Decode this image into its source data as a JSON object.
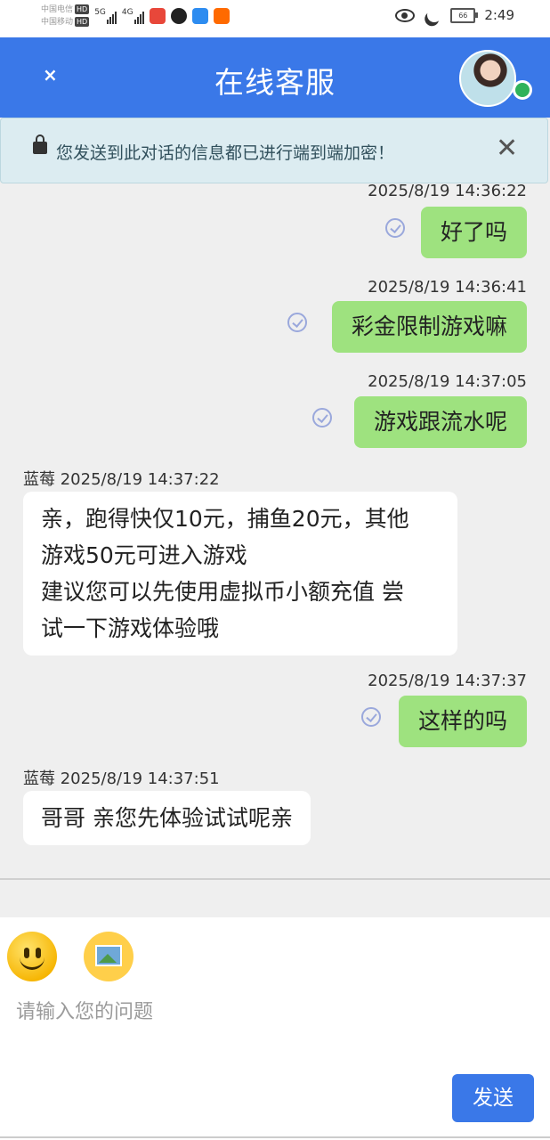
{
  "status_bar": {
    "carrier_1": "中国电信",
    "carrier_2": "中国移动",
    "hd": "HD",
    "net_1": "5G",
    "net_2": "4G",
    "battery": "66",
    "time": "2:49"
  },
  "header": {
    "close": "×",
    "title": "在线客服"
  },
  "notice": {
    "text": "您发送到此对话的信息都已进行端到端加密！",
    "close": "✕"
  },
  "messages": [
    {
      "direction": "out",
      "time": "2025/8/19 14:36:22",
      "text": "好了吗"
    },
    {
      "direction": "out",
      "time": "2025/8/19 14:36:41",
      "text": "彩金限制游戏嘛"
    },
    {
      "direction": "out",
      "time": "2025/8/19 14:37:05",
      "text": "游戏跟流水呢"
    },
    {
      "direction": "in",
      "sender": "蓝莓",
      "time": "2025/8/19 14:37:22",
      "lines": [
        "亲，跑得快仅10元，捕鱼20元，其他",
        "游戏50元可进入游戏",
        "建议您可以先使用虚拟币小额充值 尝",
        "试一下游戏体验哦"
      ]
    },
    {
      "direction": "out",
      "time": "2025/8/19 14:37:37",
      "text": "这样的吗"
    },
    {
      "direction": "in",
      "sender": "蓝莓",
      "time": "2025/8/19 14:37:51",
      "lines": [
        "哥哥 亲您先体验试试呢亲"
      ]
    }
  ],
  "input": {
    "placeholder": "请输入您的问题",
    "send_label": "发送"
  },
  "colors": {
    "header": "#3a78e8",
    "outgoing_bubble": "#9ee27f",
    "incoming_bubble": "#ffffff",
    "online": "#2fb25a"
  }
}
